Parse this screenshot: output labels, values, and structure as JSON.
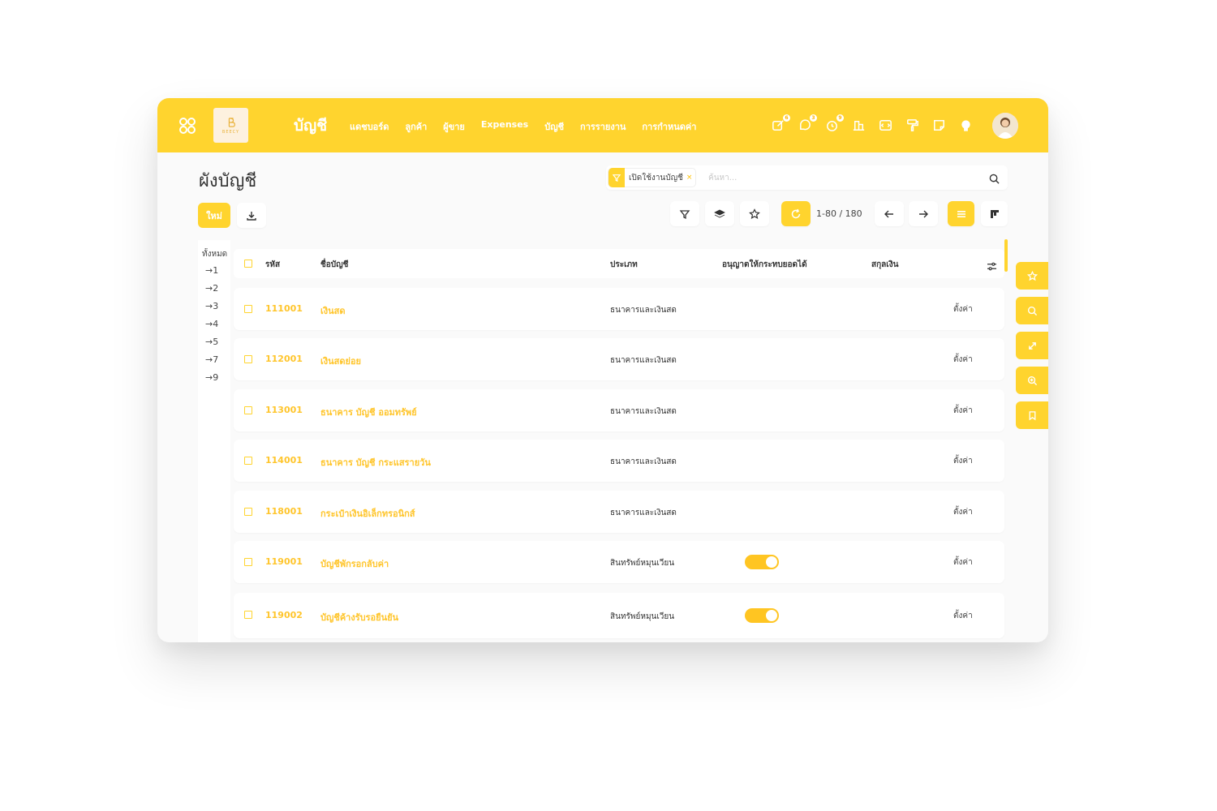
{
  "header": {
    "logo_text": "BEECY",
    "app_title": "บัญชี",
    "nav": [
      "แดชบอร์ด",
      "ลูกค้า",
      "ผู้ขาย",
      "Expenses",
      "บัญชี",
      "การรายงาน",
      "การกำหนดค่า"
    ],
    "icons": [
      {
        "name": "edit-note-icon",
        "badge": "6"
      },
      {
        "name": "chat-icon",
        "badge": "3"
      },
      {
        "name": "timer-icon",
        "badge": "9"
      },
      {
        "name": "building-icon",
        "badge": ""
      },
      {
        "name": "code-icon",
        "badge": ""
      },
      {
        "name": "paint-roller-icon",
        "badge": ""
      },
      {
        "name": "sticky-note-icon",
        "badge": ""
      },
      {
        "name": "lightbulb-icon",
        "badge": ""
      }
    ]
  },
  "page": {
    "title": "ผังบัญชี",
    "search": {
      "facet_label": "เปิดใช้งานบัญชี",
      "facet_close": "×",
      "placeholder": "ค้นหา..."
    },
    "new_button": "ใหม่",
    "pager": "1-80 / 180"
  },
  "left_panel": {
    "title": "ทั้งหมด",
    "items": [
      "→1",
      "→2",
      "→3",
      "→4",
      "→5",
      "→7",
      "→9"
    ]
  },
  "table": {
    "columns": {
      "code": "รหัส",
      "name": "ชื่อบัญชี",
      "type": "ประเภท",
      "reconcile": "อนุญาตให้กระทบยอดได้",
      "currency": "สกุลเงิน"
    },
    "rows": [
      {
        "code": "111001",
        "name": "เงินสด",
        "type": "ธนาคารและเงินสด",
        "reconcile": false,
        "action": "ตั้งค่า"
      },
      {
        "code": "112001",
        "name": "เงินสดย่อย",
        "type": "ธนาคารและเงินสด",
        "reconcile": false,
        "action": "ตั้งค่า"
      },
      {
        "code": "113001",
        "name": "ธนาคาร บัญชี ออมทรัพย์",
        "type": "ธนาคารและเงินสด",
        "reconcile": false,
        "action": "ตั้งค่า"
      },
      {
        "code": "114001",
        "name": "ธนาคาร บัญชี กระแสรายวัน",
        "type": "ธนาคารและเงินสด",
        "reconcile": false,
        "action": "ตั้งค่า"
      },
      {
        "code": "118001",
        "name": "กระเป๋าเงินอิเล็กทรอนิกส์",
        "type": "ธนาคารและเงินสด",
        "reconcile": false,
        "action": "ตั้งค่า"
      },
      {
        "code": "119001",
        "name": "บัญชีพักรอกลับค่า",
        "type": "สินทรัพย์หมุนเวียน",
        "reconcile": true,
        "action": "ตั้งค่า"
      },
      {
        "code": "119002",
        "name": "บัญชีค้างรับรอยืนยัน",
        "type": "สินทรัพย์หมุนเวียน",
        "reconcile": true,
        "action": "ตั้งค่า"
      }
    ]
  },
  "colors": {
    "accent": "#ffd42e",
    "link": "#ffc52b",
    "background": "#fafafa"
  }
}
